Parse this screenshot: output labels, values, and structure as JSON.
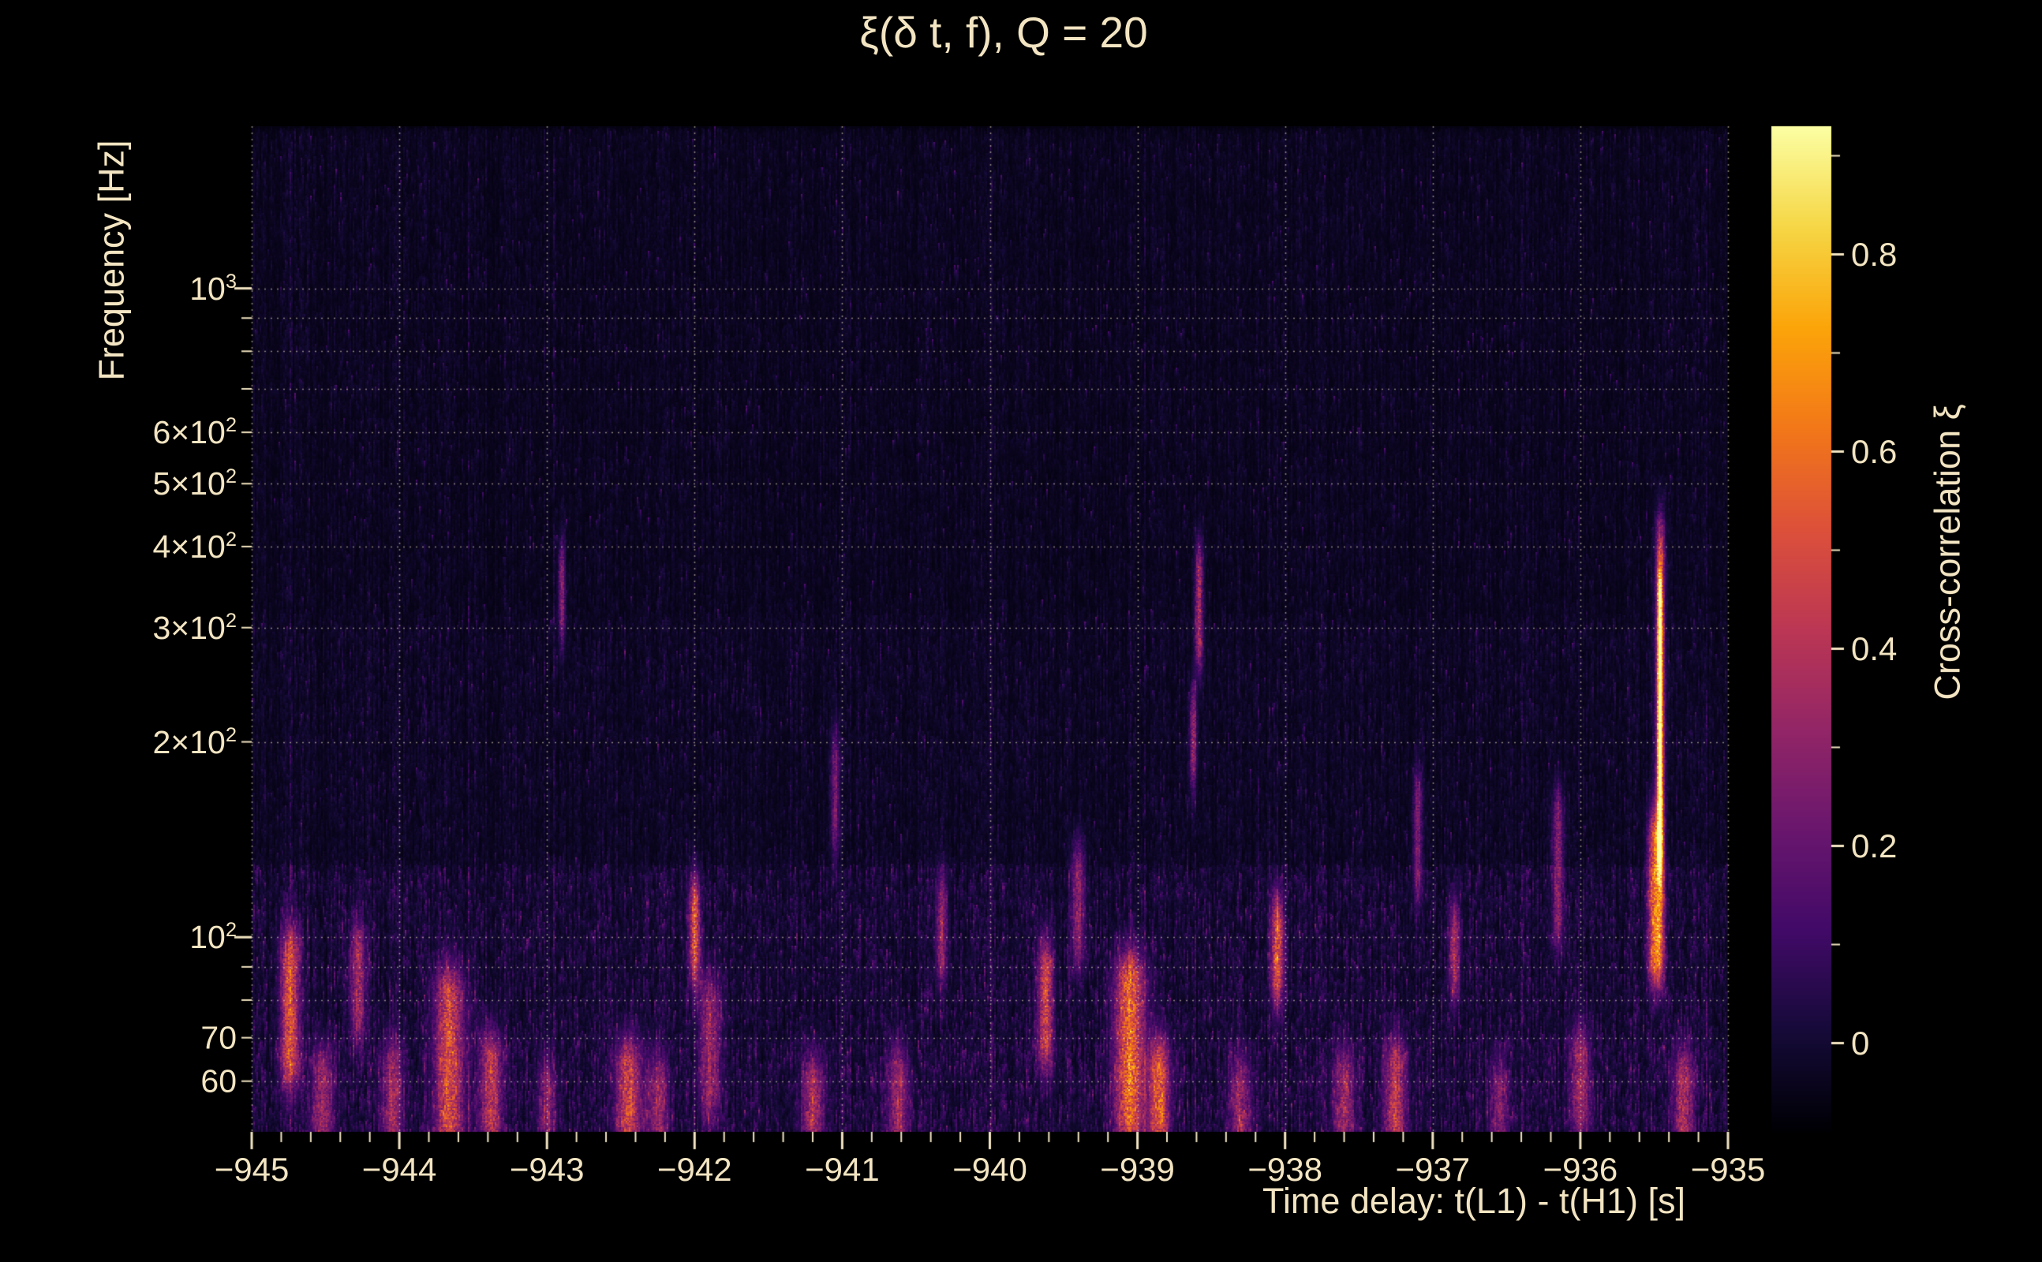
{
  "chart": {
    "title": "ξ(δ t, f), Q = 20",
    "xlabel": "Time delay: t(L1) - t(H1) [s]",
    "ylabel": "Frequency [Hz]",
    "colorbar_label": "Cross-correlation ξ"
  },
  "chart_data": {
    "type": "heatmap",
    "title": "ξ(δ t, f), Q = 20",
    "xlabel": "Time delay: t(L1) - t(H1) [s]",
    "ylabel": "Frequency [Hz]",
    "colorbar_label": "Cross-correlation ξ",
    "x_range": [
      -945,
      -935
    ],
    "y_range_hz": [
      50.12,
      1778
    ],
    "y_scale": "log",
    "color_range": [
      -0.09,
      0.93
    ],
    "colormap": "inferno",
    "background": "#000000",
    "text_color": "#f3e5c2",
    "grid": {
      "style": "dotted",
      "x_lines": [
        -945,
        -944,
        -943,
        -942,
        -941,
        -940,
        -939,
        -938,
        -937,
        -936,
        -935
      ],
      "y_lines_hz": [
        60,
        70,
        80,
        90,
        100,
        200,
        300,
        400,
        500,
        600,
        700,
        800,
        900,
        1000
      ]
    },
    "x_ticks": {
      "major": [
        -945,
        -944,
        -943,
        -942,
        -941,
        -940,
        -939,
        -938,
        -937,
        -936,
        -935
      ],
      "labels": [
        "−945",
        "−944",
        "−943",
        "−942",
        "−941",
        "−940",
        "−939",
        "−938",
        "−937",
        "−936",
        "−935"
      ],
      "minor_step": 0.2
    },
    "y_ticks": {
      "major_hz": [
        100,
        1000
      ],
      "minor_hz": [
        60,
        70,
        80,
        90,
        200,
        300,
        400,
        500,
        600,
        700,
        800,
        900
      ],
      "labeled": [
        {
          "pre": "10",
          "sup": "3",
          "hz": 1000
        },
        {
          "pre": "6×10",
          "sup": "2",
          "hz": 600
        },
        {
          "pre": "5×10",
          "sup": "2",
          "hz": 500
        },
        {
          "pre": "4×10",
          "sup": "2",
          "hz": 400
        },
        {
          "pre": "3×10",
          "sup": "2",
          "hz": 300
        },
        {
          "pre": "2×10",
          "sup": "2",
          "hz": 200
        },
        {
          "pre": "10",
          "sup": "2",
          "hz": 100
        },
        {
          "pre": "70",
          "sup": "",
          "hz": 70
        },
        {
          "pre": "60",
          "sup": "",
          "hz": 60
        }
      ]
    },
    "colorbar_ticks": {
      "major": [
        0,
        0.2,
        0.4,
        0.6,
        0.8
      ],
      "labels": [
        "0",
        "0.2",
        "0.4",
        "0.6",
        "0.8"
      ],
      "minor": [
        0.1,
        0.3,
        0.5,
        0.7,
        0.9
      ]
    },
    "noise_field": {
      "description": "dark-purple vertically-striated correlation noise, mean xi ~ 0, stronger speckle below 130 Hz and near 55-60 Hz",
      "seed": 1234,
      "base_value": -0.07,
      "mean_excess": 0.042,
      "lowfreq_boost_hz": 130,
      "lowfreq_gain": 1.9
    },
    "hotspots": [
      {
        "t": -944.74,
        "f_lo": 66,
        "f_hi": 92,
        "peak": 0.48,
        "w": 0.045
      },
      {
        "t": -944.52,
        "f_lo": 52,
        "f_hi": 60,
        "peak": 0.32,
        "w": 0.05
      },
      {
        "t": -944.28,
        "f_lo": 78,
        "f_hi": 94,
        "peak": 0.34,
        "w": 0.035
      },
      {
        "t": -944.05,
        "f_lo": 52,
        "f_hi": 62,
        "peak": 0.3,
        "w": 0.05
      },
      {
        "t": -943.66,
        "f_lo": 52,
        "f_hi": 80,
        "peak": 0.45,
        "w": 0.07
      },
      {
        "t": -943.38,
        "f_lo": 52,
        "f_hi": 64,
        "peak": 0.42,
        "w": 0.05
      },
      {
        "t": -943.0,
        "f_lo": 52,
        "f_hi": 58,
        "peak": 0.28,
        "w": 0.04
      },
      {
        "t": -942.9,
        "f_lo": 320,
        "f_hi": 360,
        "peak": 0.32,
        "w": 0.016
      },
      {
        "t": -942.45,
        "f_lo": 52,
        "f_hi": 62,
        "peak": 0.44,
        "w": 0.06
      },
      {
        "t": -942.25,
        "f_lo": 52,
        "f_hi": 58,
        "peak": 0.3,
        "w": 0.05
      },
      {
        "t": -942.0,
        "f_lo": 95,
        "f_hi": 110,
        "peak": 0.52,
        "w": 0.025
      },
      {
        "t": -941.9,
        "f_lo": 58,
        "f_hi": 78,
        "peak": 0.3,
        "w": 0.05
      },
      {
        "t": -941.2,
        "f_lo": 52,
        "f_hi": 58,
        "peak": 0.36,
        "w": 0.05
      },
      {
        "t": -941.05,
        "f_lo": 150,
        "f_hi": 185,
        "peak": 0.26,
        "w": 0.02
      },
      {
        "t": -940.62,
        "f_lo": 52,
        "f_hi": 60,
        "peak": 0.3,
        "w": 0.05
      },
      {
        "t": -940.33,
        "f_lo": 95,
        "f_hi": 112,
        "peak": 0.3,
        "w": 0.025
      },
      {
        "t": -939.62,
        "f_lo": 70,
        "f_hi": 88,
        "peak": 0.46,
        "w": 0.035
      },
      {
        "t": -939.4,
        "f_lo": 100,
        "f_hi": 125,
        "peak": 0.3,
        "w": 0.03
      },
      {
        "t": -939.05,
        "f_lo": 54,
        "f_hi": 84,
        "peak": 0.56,
        "w": 0.07
      },
      {
        "t": -938.85,
        "f_lo": 52,
        "f_hi": 62,
        "peak": 0.5,
        "w": 0.05
      },
      {
        "t": -938.62,
        "f_lo": 190,
        "f_hi": 215,
        "peak": 0.34,
        "w": 0.016
      },
      {
        "t": -938.58,
        "f_lo": 290,
        "f_hi": 360,
        "peak": 0.4,
        "w": 0.018
      },
      {
        "t": -938.3,
        "f_lo": 52,
        "f_hi": 58,
        "peak": 0.3,
        "w": 0.05
      },
      {
        "t": -938.05,
        "f_lo": 88,
        "f_hi": 103,
        "peak": 0.5,
        "w": 0.03
      },
      {
        "t": -937.6,
        "f_lo": 52,
        "f_hi": 60,
        "peak": 0.3,
        "w": 0.05
      },
      {
        "t": -937.25,
        "f_lo": 52,
        "f_hi": 62,
        "peak": 0.4,
        "w": 0.05
      },
      {
        "t": -937.1,
        "f_lo": 128,
        "f_hi": 160,
        "peak": 0.26,
        "w": 0.022
      },
      {
        "t": -936.85,
        "f_lo": 90,
        "f_hi": 100,
        "peak": 0.36,
        "w": 0.025
      },
      {
        "t": -936.55,
        "f_lo": 52,
        "f_hi": 58,
        "peak": 0.26,
        "w": 0.04
      },
      {
        "t": -936.15,
        "f_lo": 108,
        "f_hi": 150,
        "peak": 0.3,
        "w": 0.025
      },
      {
        "t": -936.0,
        "f_lo": 55,
        "f_hi": 65,
        "peak": 0.32,
        "w": 0.045
      },
      {
        "t": -935.5,
        "f_lo": 95,
        "f_hi": 140,
        "peak": 0.5,
        "w": 0.03
      },
      {
        "t": -935.46,
        "f_lo": 95,
        "f_hi": 400,
        "peak": 0.42,
        "w": 0.022
      },
      {
        "t": -935.46,
        "f_lo": 140,
        "f_hi": 330,
        "peak": 0.8,
        "w": 0.012
      },
      {
        "t": -935.3,
        "f_lo": 52,
        "f_hi": 60,
        "peak": 0.36,
        "w": 0.045
      }
    ]
  }
}
